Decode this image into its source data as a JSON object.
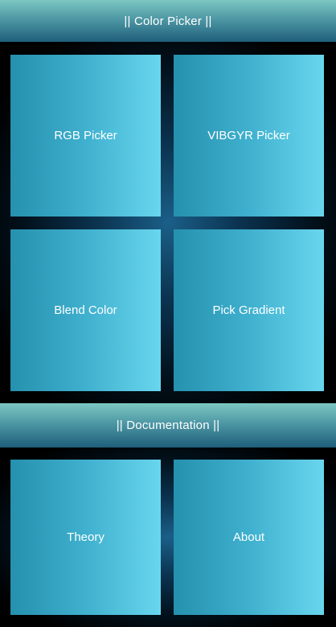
{
  "color_picker_section": {
    "title": "|| Color Picker ||",
    "tiles": [
      {
        "label": "RGB Picker"
      },
      {
        "label": "VIBGYR Picker"
      },
      {
        "label": "Blend Color"
      },
      {
        "label": "Pick Gradient"
      }
    ]
  },
  "documentation_section": {
    "title": "|| Documentation ||",
    "tiles": [
      {
        "label": "Theory"
      },
      {
        "label": "About"
      }
    ]
  },
  "colors": {
    "tile_gradient_start": "#2591ae",
    "tile_gradient_end": "#69d6ee",
    "header_top": "#7cc7c2",
    "header_bottom": "#1f5e7a",
    "background": "#000000"
  }
}
